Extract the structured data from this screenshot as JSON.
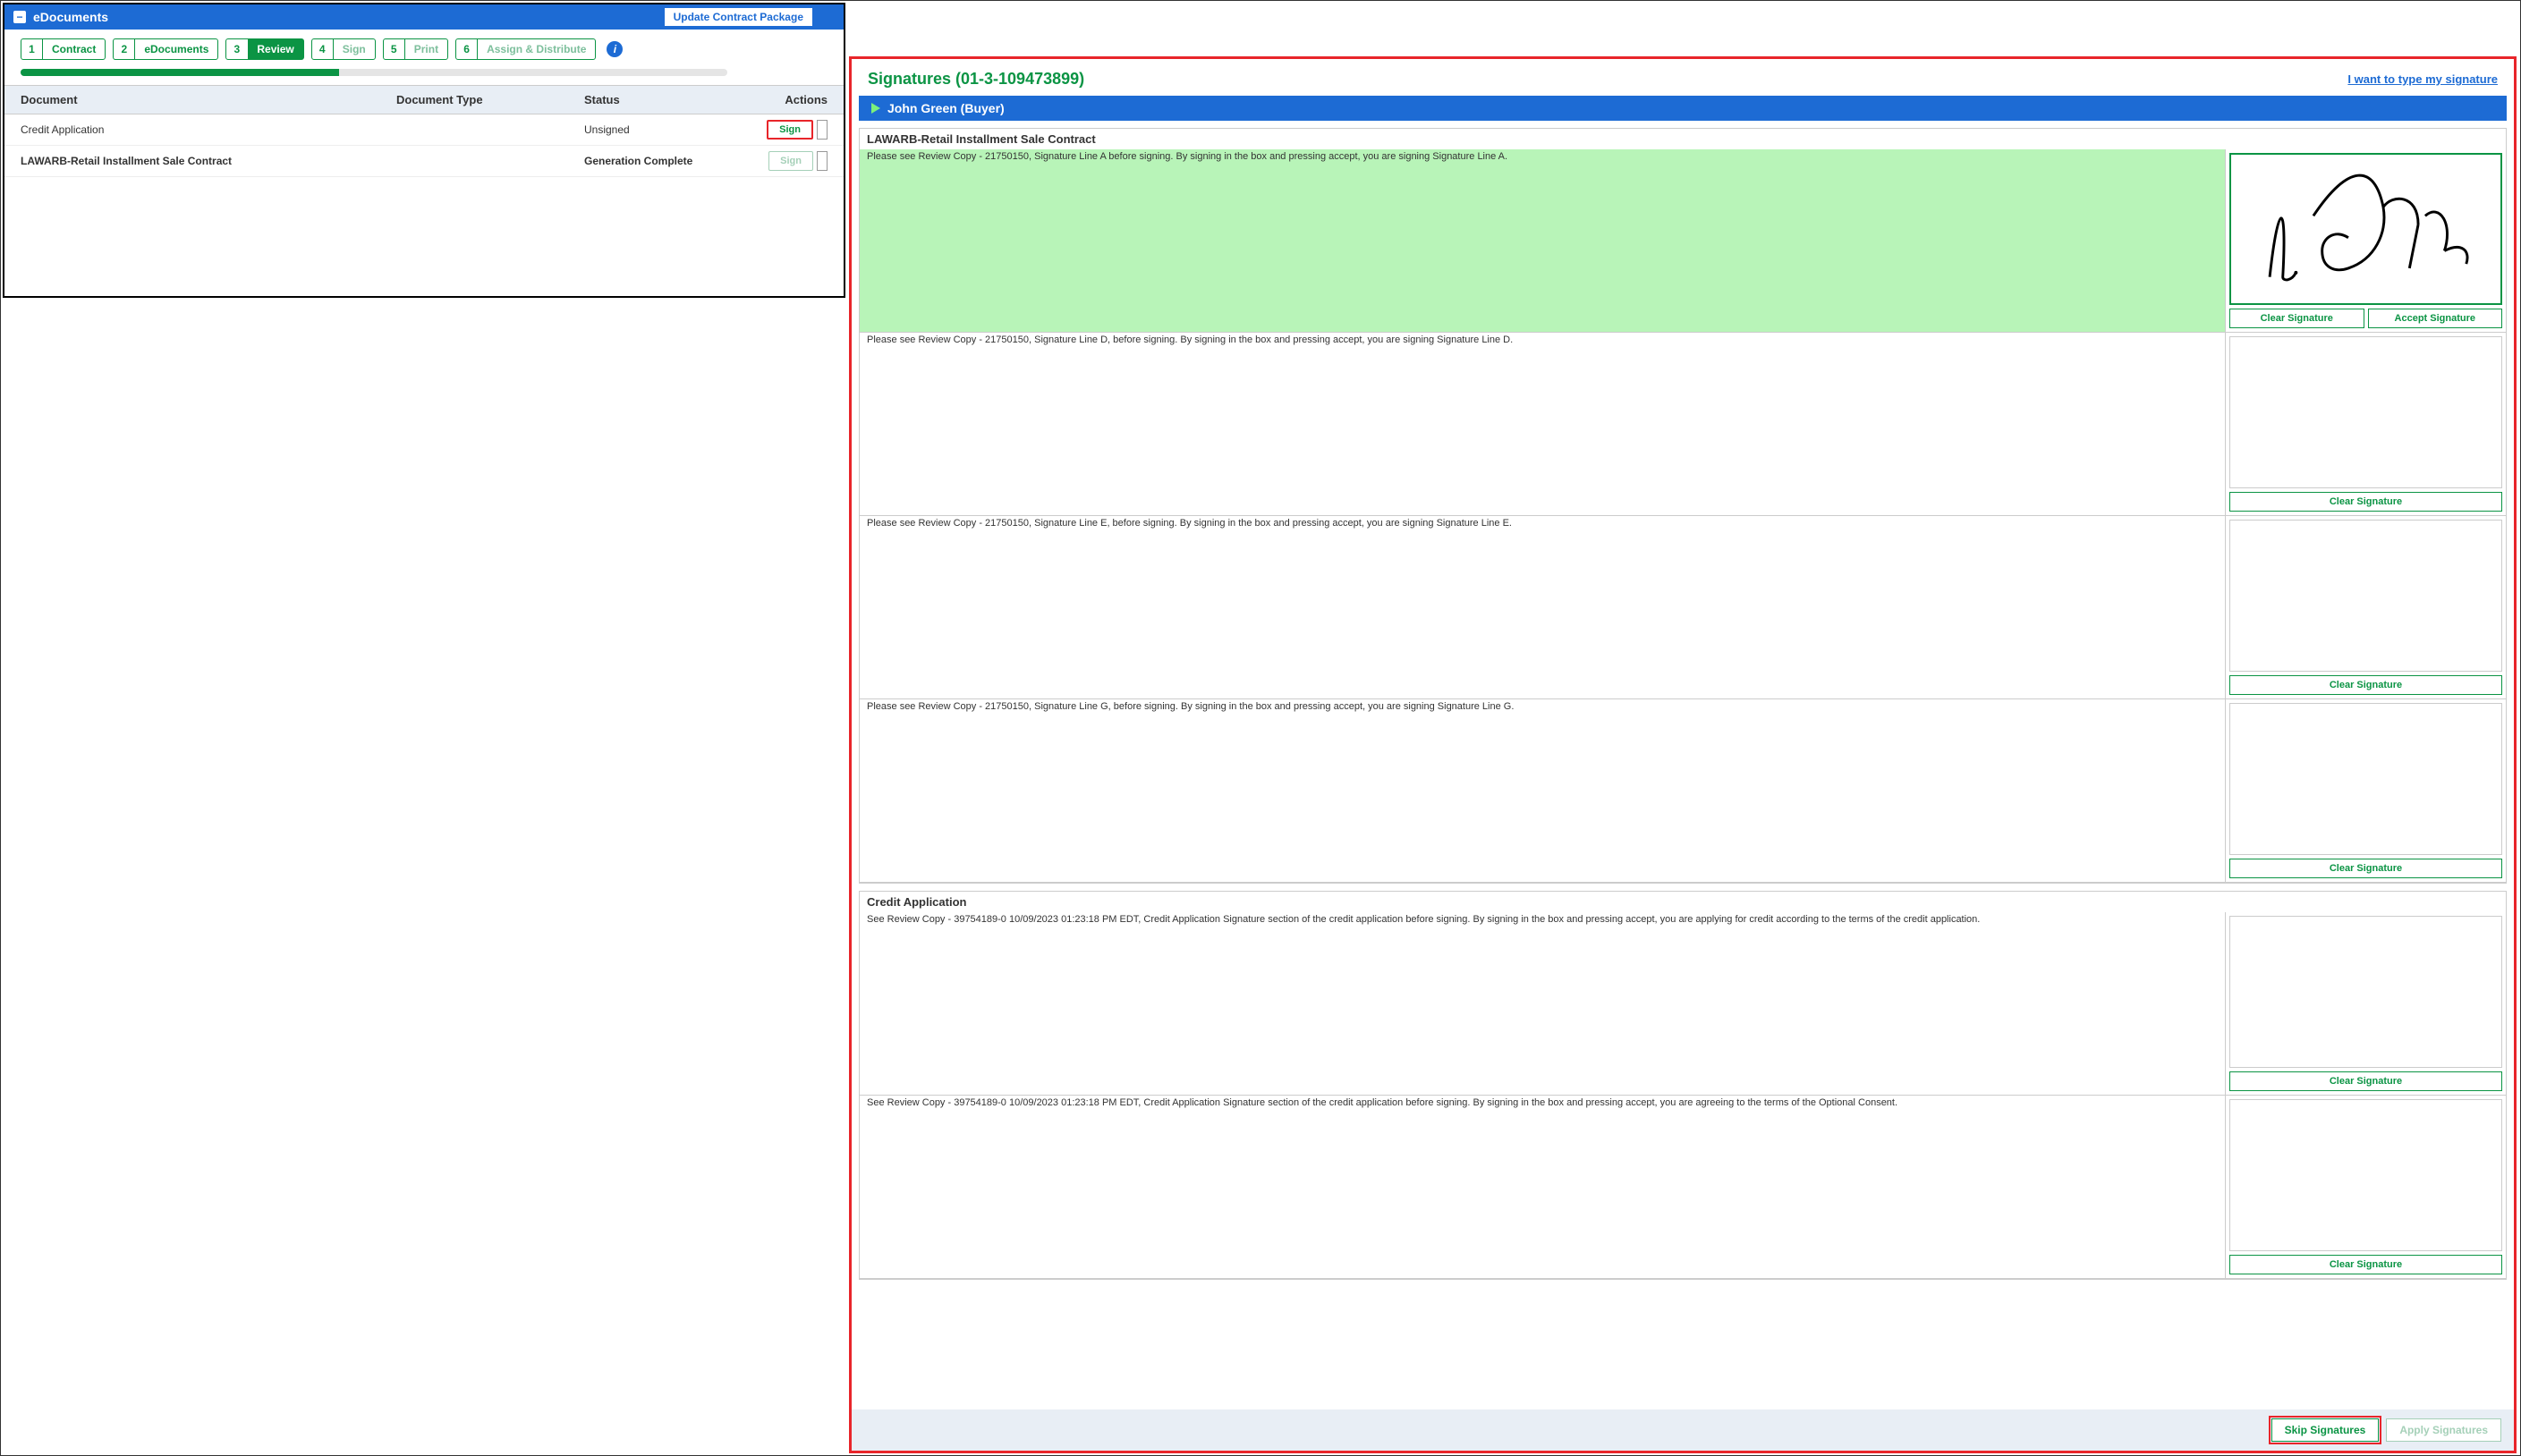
{
  "panel": {
    "title": "eDocuments",
    "updateBtn": "Update Contract Package",
    "collapseIcon": "−"
  },
  "steps": [
    {
      "num": "1",
      "label": "Contract",
      "state": "normal"
    },
    {
      "num": "2",
      "label": "eDocuments",
      "state": "normal"
    },
    {
      "num": "3",
      "label": "Review",
      "state": "active"
    },
    {
      "num": "4",
      "label": "Sign",
      "state": "disabled"
    },
    {
      "num": "5",
      "label": "Print",
      "state": "disabled"
    },
    {
      "num": "6",
      "label": "Assign & Distribute",
      "state": "disabled"
    }
  ],
  "infoIcon": "i",
  "tableHeaders": {
    "doc": "Document",
    "type": "Document Type",
    "status": "Status",
    "actions": "Actions"
  },
  "docs": [
    {
      "name": "Credit Application",
      "type": "",
      "status": "Unsigned",
      "signLabel": "Sign",
      "signClass": "highlighted",
      "bold": false
    },
    {
      "name": "LAWARB-Retail Installment Sale Contract",
      "type": "",
      "status": "Generation Complete",
      "signLabel": "Sign",
      "signClass": "disabled",
      "bold": true
    }
  ],
  "signatures": {
    "title": "Signatures (01-3-109473899)",
    "typeLink": "I want to type my signature",
    "buyer": "John Green (Buyer)",
    "sections": [
      {
        "title": "LAWARB-Retail Installment Sale Contract",
        "rows": [
          {
            "text": "Please see Review Copy - 21750150, Signature Line A before signing. By signing in the box and pressing accept, you are signing Signature Line A.",
            "hasSignature": true,
            "active": true
          },
          {
            "text": "Please see Review Copy - 21750150, Signature Line D, before signing. By signing in the box and pressing accept, you are signing Signature Line D.",
            "hasSignature": false,
            "active": false
          },
          {
            "text": "Please see Review Copy - 21750150, Signature Line E, before signing. By signing in the box and pressing accept, you are signing Signature Line E.",
            "hasSignature": false,
            "active": false
          },
          {
            "text": "Please see Review Copy - 21750150, Signature Line G, before signing. By signing in the box and pressing accept, you are signing Signature Line G.",
            "hasSignature": false,
            "active": false
          }
        ]
      },
      {
        "title": "Credit Application",
        "rows": [
          {
            "text": "See Review Copy - 39754189-0 10/09/2023 01:23:18 PM EDT, Credit Application Signature section of the credit application before signing. By signing in the box and pressing accept, you are applying for credit according to the terms of the credit application.",
            "hasSignature": false,
            "active": false
          },
          {
            "text": "See Review Copy - 39754189-0 10/09/2023 01:23:18 PM EDT, Credit Application Signature section of the credit application before signing. By signing in the box and pressing accept, you are agreeing to the terms of the Optional Consent.",
            "hasSignature": false,
            "active": false
          }
        ]
      }
    ],
    "clearLabel": "Clear Signature",
    "acceptLabel": "Accept Signature",
    "skipLabel": "Skip Signatures",
    "applyLabel": "Apply Signatures"
  }
}
